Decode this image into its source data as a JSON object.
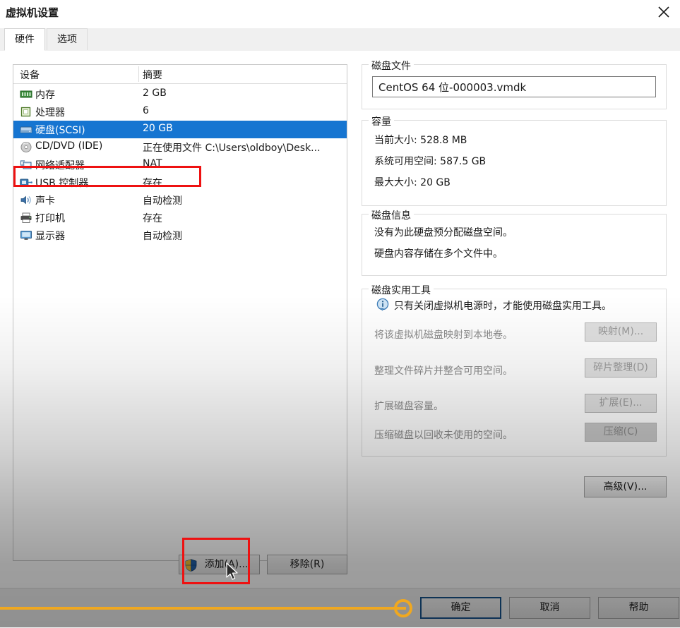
{
  "window": {
    "title": "虚拟机设置",
    "close_icon": "close-icon"
  },
  "tabs": [
    {
      "label": "硬件",
      "active": true
    },
    {
      "label": "选项",
      "active": false
    }
  ],
  "device_list": {
    "columns": [
      "设备",
      "摘要"
    ],
    "rows": [
      {
        "icon": "memory-icon",
        "name": "内存",
        "summary": "2 GB",
        "selected": false
      },
      {
        "icon": "cpu-icon",
        "name": "处理器",
        "summary": "6",
        "selected": false
      },
      {
        "icon": "harddisk-icon",
        "name": "硬盘(SCSI)",
        "summary": "20 GB",
        "selected": true
      },
      {
        "icon": "cddvd-icon",
        "name": "CD/DVD (IDE)",
        "summary": "正在使用文件 C:\\Users\\oldboy\\Desk...",
        "selected": false
      },
      {
        "icon": "network-icon",
        "name": "网络适配器",
        "summary": "NAT",
        "selected": false
      },
      {
        "icon": "usb-icon",
        "name": "USB 控制器",
        "summary": "存在",
        "selected": false
      },
      {
        "icon": "sound-icon",
        "name": "声卡",
        "summary": "自动检测",
        "selected": false
      },
      {
        "icon": "printer-icon",
        "name": "打印机",
        "summary": "存在",
        "selected": false
      },
      {
        "icon": "display-icon",
        "name": "显示器",
        "summary": "自动检测",
        "selected": false
      }
    ],
    "add_button": "添加(A)...",
    "remove_button": "移除(R)",
    "add_button_icon": "shield-icon"
  },
  "disk_file": {
    "group_title": "磁盘文件",
    "value": "CentOS 64 位-000003.vmdk"
  },
  "capacity": {
    "group_title": "容量",
    "lines": [
      "当前大小: 528.8 MB",
      "系统可用空间: 587.5 GB",
      "最大大小: 20 GB"
    ]
  },
  "disk_info": {
    "group_title": "磁盘信息",
    "lines": [
      "没有为此硬盘预分配磁盘空间。",
      "硬盘内容存储在多个文件中。"
    ]
  },
  "disk_utilities": {
    "group_title": "磁盘实用工具",
    "note": "只有关闭虚拟机电源时，才能使用磁盘实用工具。",
    "note_icon": "info-icon",
    "rows": [
      {
        "label": "将该虚拟机磁盘映射到本地卷。",
        "button": "映射(M)...",
        "enabled": false
      },
      {
        "label": "整理文件碎片并整合可用空间。",
        "button": "碎片整理(D)",
        "enabled": false
      },
      {
        "label": "扩展磁盘容量。",
        "button": "扩展(E)...",
        "enabled": false
      },
      {
        "label": "压缩磁盘以回收未使用的空间。",
        "button": "压缩(C)",
        "enabled": false
      }
    ],
    "advanced_button": "高级(V)..."
  },
  "footer": {
    "ok": "确定",
    "cancel": "取消",
    "help": "帮助"
  },
  "annotations": {
    "highlight_color": "#ee1111",
    "marker_color": "#f0a820",
    "cursor_icon": "mouse-pointer-icon"
  }
}
